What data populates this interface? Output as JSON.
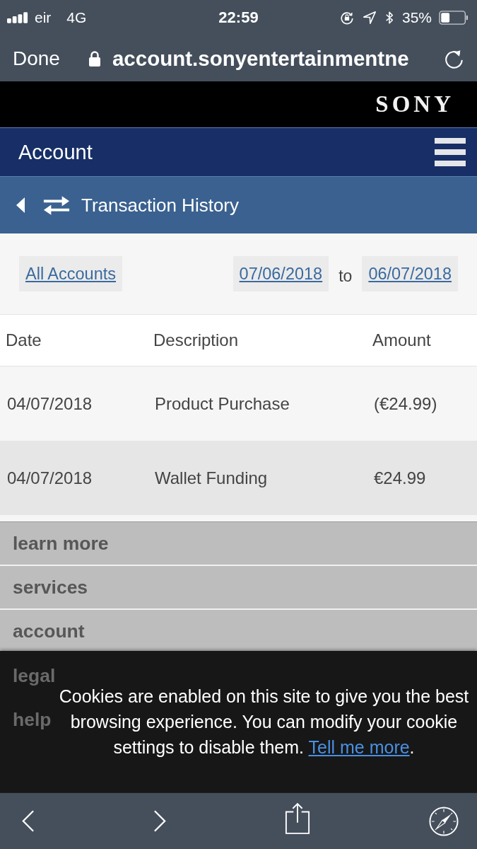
{
  "status_bar": {
    "carrier": "eir",
    "network": "4G",
    "time": "22:59",
    "battery": "35%"
  },
  "browser": {
    "done": "Done",
    "url": "account.sonyentertainmentne"
  },
  "brand": {
    "logo": "SONY"
  },
  "header": {
    "title": "Account"
  },
  "subheader": {
    "title": "Transaction History"
  },
  "filters": {
    "account": "All Accounts",
    "from": "07/06/2018",
    "separator": "to",
    "to": "06/07/2018"
  },
  "table": {
    "columns": [
      "Date",
      "Description",
      "Amount"
    ],
    "rows": [
      [
        "04/07/2018",
        "Product Purchase",
        "(€24.99)"
      ],
      [
        "04/07/2018",
        "Wallet Funding",
        "€24.99"
      ]
    ]
  },
  "footer_menu": [
    {
      "label": "learn more",
      "dimmed": false
    },
    {
      "label": "services",
      "dimmed": false
    },
    {
      "label": "account",
      "dimmed": false
    },
    {
      "label": "legal",
      "dimmed": true
    },
    {
      "label": "help",
      "dimmed": true
    }
  ],
  "cookie_banner": {
    "text": "Cookies are enabled on this site to give you the best browsing experience. You can modify your cookie settings to disable them.",
    "link": "Tell me more",
    "after_link": "."
  }
}
